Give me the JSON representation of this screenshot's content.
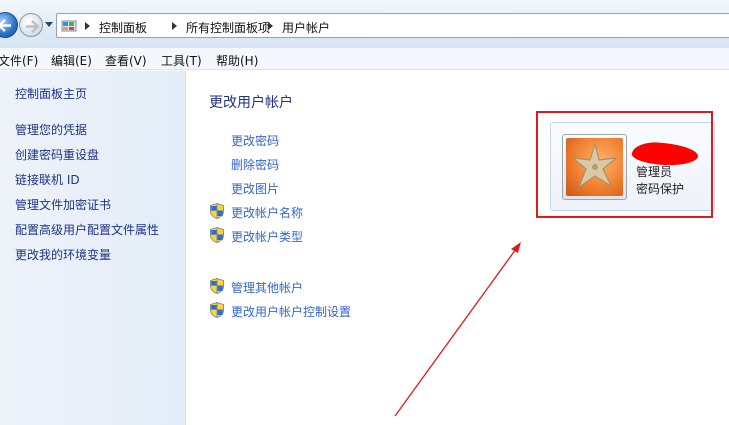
{
  "address_bar": {
    "breadcrumbs": [
      "控制面板",
      "所有控制面板项",
      "用户帐户"
    ]
  },
  "menu": {
    "items": [
      "文件(F)",
      "编辑(E)",
      "查看(V)",
      "工具(T)",
      "帮助(H)"
    ]
  },
  "sidebar": {
    "home": "控制面板主页",
    "tasks": [
      "管理您的凭据",
      "创建密码重设盘",
      "链接联机 ID",
      "管理文件加密证书",
      "配置高级用户配置文件属性",
      "更改我的环境变量"
    ]
  },
  "main": {
    "title": "更改用户帐户",
    "links": [
      "更改密码",
      "删除密码",
      "更改图片",
      "更改帐户名称",
      "更改帐户类型"
    ],
    "other_links": [
      "管理其他帐户",
      "更改用户帐户控制设置"
    ]
  },
  "account": {
    "type": "管理员",
    "status": "密码保护"
  },
  "colors": {
    "link": "#3366cc",
    "title": "#1e3287",
    "annotation": "#e0191f"
  }
}
